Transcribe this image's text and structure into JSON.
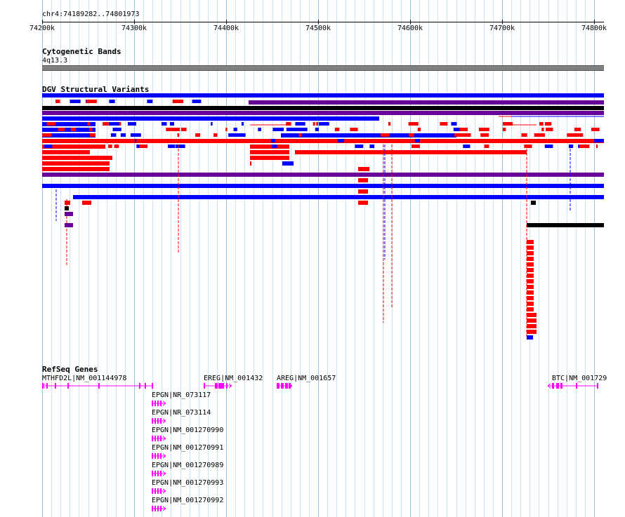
{
  "ruler": {
    "location": "chr4:74189282..74801973",
    "ticks": [
      "74200k",
      "74300k",
      "74400k",
      "74500k",
      "74600k",
      "74700k",
      "74800k"
    ]
  },
  "tracks": {
    "cytoband": {
      "title": "Cytogenetic Bands",
      "band": "4q13.3",
      "color": "#808080"
    },
    "dgv": {
      "title": "DGV Structural Variants",
      "colors": {
        "gain": "#0000ff",
        "loss": "#ff0000",
        "both": "#660099",
        "other": "#000000"
      }
    },
    "refseq": {
      "title": "RefSeq Genes",
      "color": "#ff00ff"
    }
  },
  "genes": [
    {
      "label": "MTHFD2L|NM_001144978",
      "strand": "-"
    },
    {
      "label": "EREG|NM_001432",
      "strand": "+"
    },
    {
      "label": "AREG|NM_001657",
      "strand": "+"
    },
    {
      "label": "BTC|NM_001729",
      "strand": "-"
    },
    {
      "label": "EPGN|NR_073117",
      "strand": "+"
    },
    {
      "label": "EPGN|NR_073114",
      "strand": "+"
    },
    {
      "label": "EPGN|NM_001270990",
      "strand": "+"
    },
    {
      "label": "EPGN|NM_001270991",
      "strand": "+"
    },
    {
      "label": "EPGN|NM_001270989",
      "strand": "+"
    },
    {
      "label": "EPGN|NM_001270993",
      "strand": "+"
    },
    {
      "label": "EPGN|NM_001270992",
      "strand": "+"
    }
  ]
}
